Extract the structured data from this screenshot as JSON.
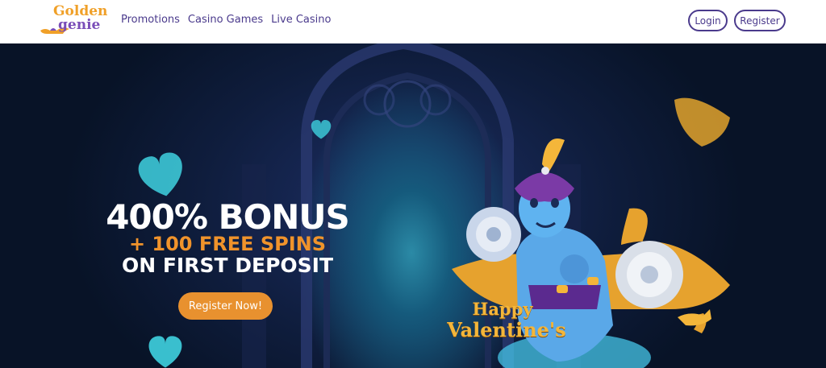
{
  "brand": {
    "logo_line1": "Golden",
    "logo_line2": "genie"
  },
  "nav": {
    "items": [
      "Promotions",
      "Casino Games",
      "Live Casino"
    ]
  },
  "header": {
    "login_label": "Login",
    "register_label": "Register"
  },
  "hero": {
    "headline": "400% BONUS",
    "subheadline": "+ 100 FREE SPINS",
    "subheadline2": "ON FIRST DEPOSIT",
    "cta_label": "Register Now!",
    "seasonal_line1": "Happy",
    "seasonal_line2": "Valentine's"
  },
  "colors": {
    "brand_purple": "#4a3a8c",
    "brand_orange": "#e8912f",
    "hero_bg": "#0f1d3d",
    "accent_teal": "#3fd2e0"
  },
  "icons": [
    "lamp-logo-icon",
    "heart-icon",
    "genie-character",
    "rose-icon",
    "magic-lamp-icon"
  ]
}
